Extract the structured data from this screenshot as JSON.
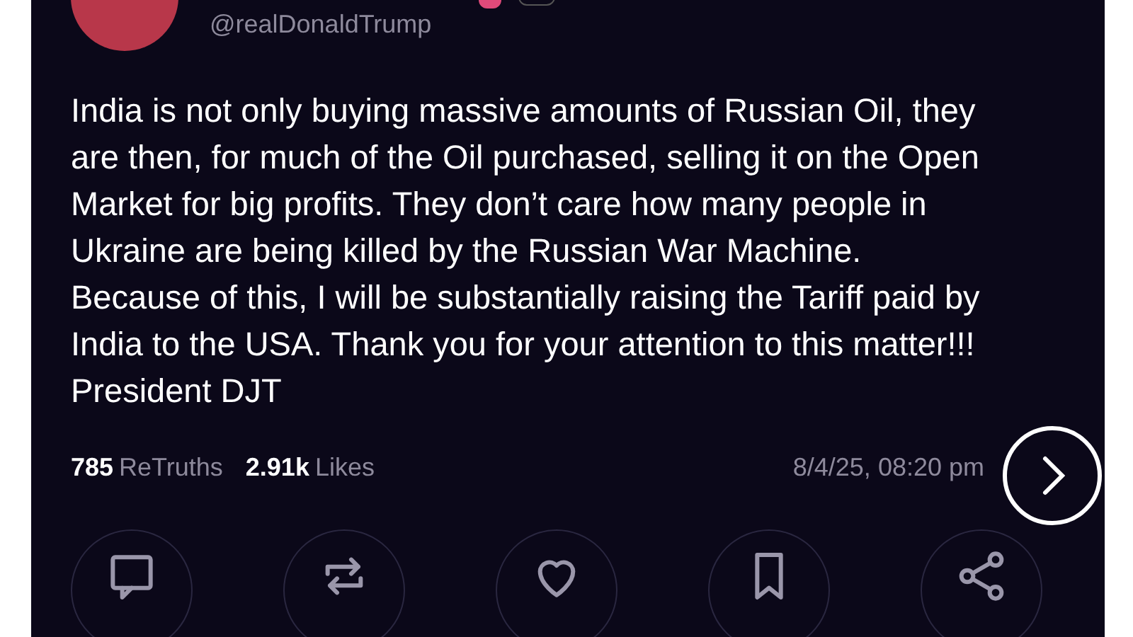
{
  "post": {
    "handle": "@realDonaldTrump",
    "text": "India is not only buying massive amounts of Russian Oil, they are then, for much of the Oil purchased, selling it on the Open Market for big profits. They don’t care how many people in Ukraine are being killed by the Russian War Machine. Because of this, I will be substantially raising the Tariff paid by India to the USA. Thank you for your attention to this matter!!! President DJT",
    "stats": [
      {
        "count": "785",
        "label": "ReTruths"
      },
      {
        "count": "2.91k",
        "label": "Likes"
      }
    ],
    "timestamp": "8/4/25, 08:20 pm"
  },
  "actions": [
    {
      "kind": "reply"
    },
    {
      "kind": "retruth"
    },
    {
      "kind": "like"
    },
    {
      "kind": "bookmark"
    },
    {
      "kind": "share"
    }
  ]
}
